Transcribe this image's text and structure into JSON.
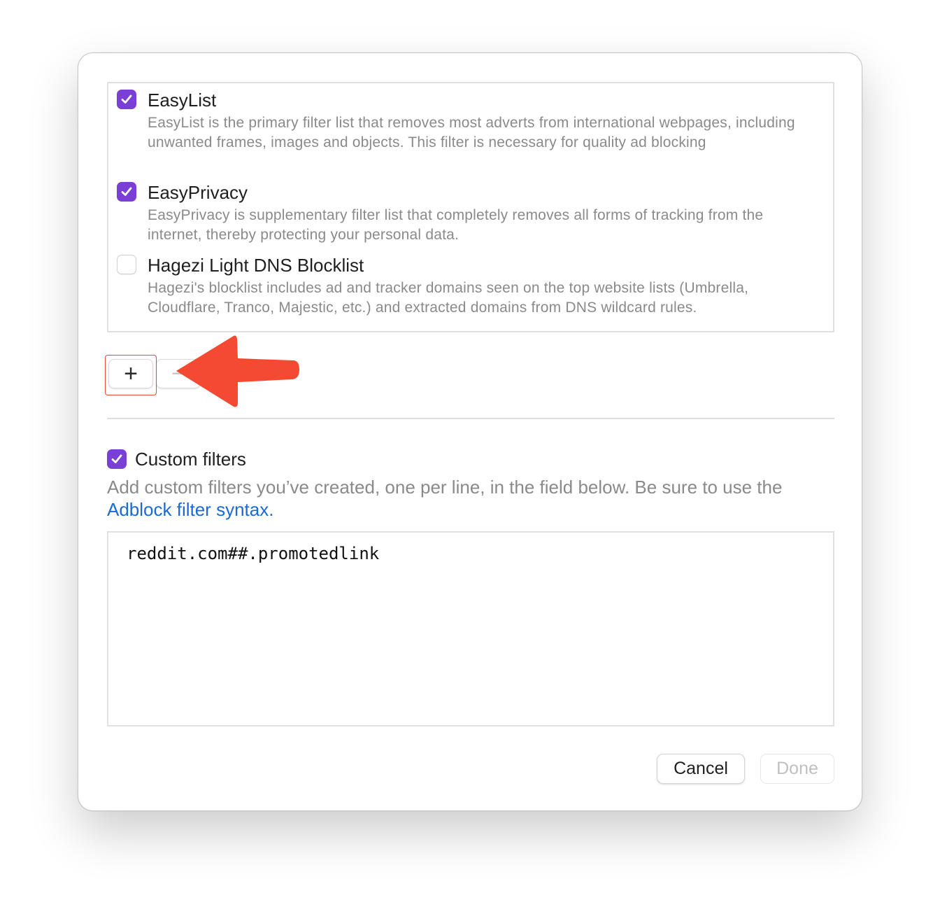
{
  "filter_lists": [
    {
      "title": "EasyList",
      "checked": true,
      "description": "EasyList is the primary filter list that removes most adverts from international webpages, including unwanted frames, images and objects. This filter is necessary for quality ad blocking"
    },
    {
      "title": "EasyPrivacy",
      "checked": true,
      "description": "EasyPrivacy is supplementary filter list that completely removes all forms of tracking from the internet, thereby protecting your personal data."
    },
    {
      "title": "Hagezi Light DNS Blocklist",
      "checked": false,
      "description": "Hagezi's blocklist includes ad and tracker domains seen on the top website lists (Umbrella, Cloudflare, Tranco, Majestic, etc.) and extracted domains from DNS wildcard rules."
    }
  ],
  "list_controls": {
    "add_label": "+",
    "remove_label": "−"
  },
  "custom_filters": {
    "checked": true,
    "title": "Custom filters",
    "description": "Add custom filters you’ve created, one per line, in the field below. Be sure to use the",
    "link_text": "Adblock filter syntax",
    "link_suffix": ".",
    "value": "reddit.com##.promotedlink"
  },
  "footer": {
    "cancel_label": "Cancel",
    "done_label": "Done"
  },
  "colors": {
    "accent": "#7a3fd4",
    "link": "#1a6ad6",
    "annotation": "#f44a32"
  }
}
